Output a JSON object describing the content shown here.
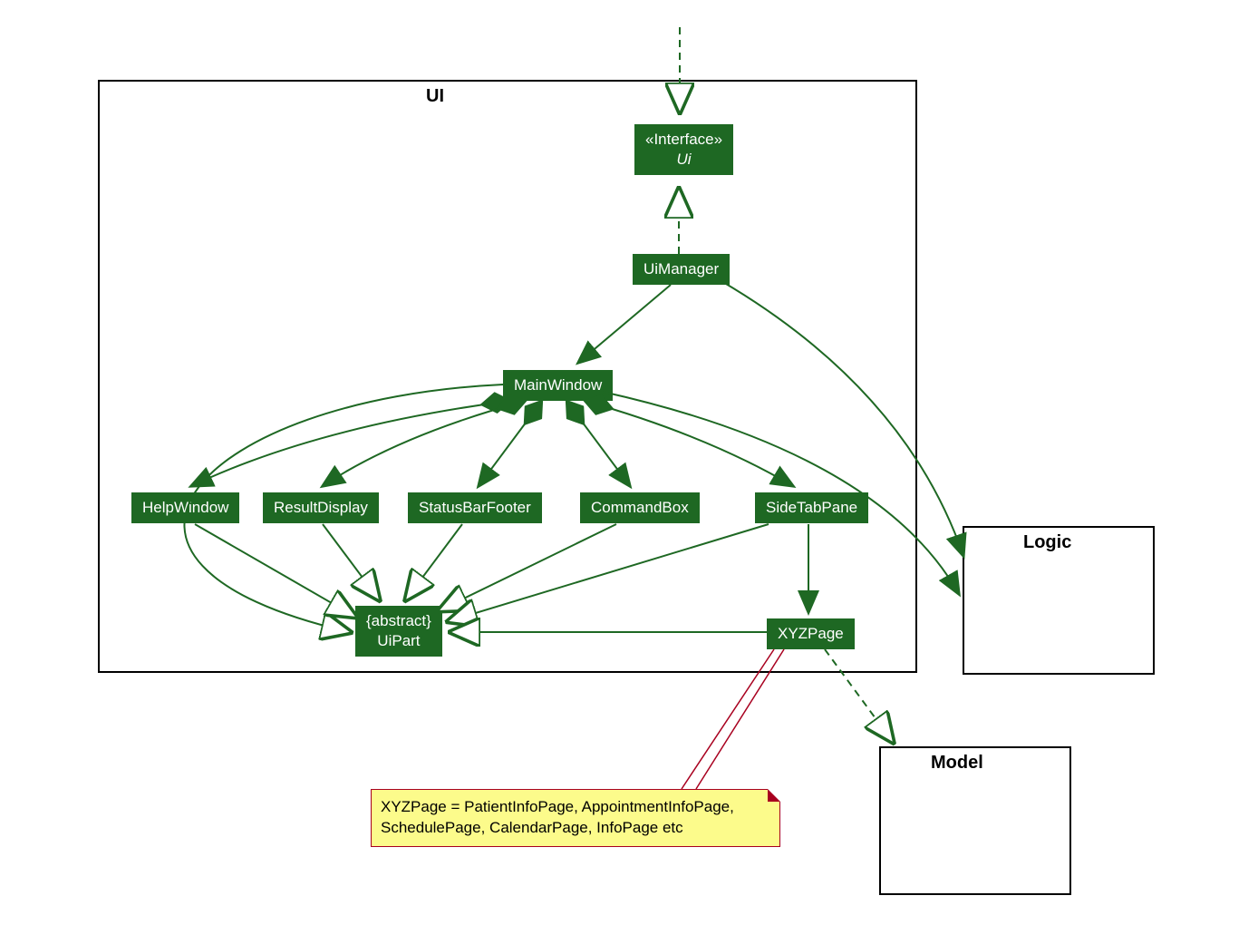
{
  "packages": {
    "ui": {
      "label": "UI"
    },
    "logic": {
      "label": "Logic"
    },
    "model": {
      "label": "Model"
    }
  },
  "classes": {
    "uiInterface": {
      "stereotype": "«Interface»",
      "name": "Ui"
    },
    "uiManager": {
      "name": "UiManager"
    },
    "mainWindow": {
      "name": "MainWindow"
    },
    "helpWindow": {
      "name": "HelpWindow"
    },
    "resultDisplay": {
      "name": "ResultDisplay"
    },
    "statusBarFooter": {
      "name": "StatusBarFooter"
    },
    "commandBox": {
      "name": "CommandBox"
    },
    "sideTabPane": {
      "name": "SideTabPane"
    },
    "uiPart": {
      "stereotype": "{abstract}",
      "name": "UiPart"
    },
    "xyzPage": {
      "name": "XYZPage"
    }
  },
  "note": {
    "text": "XYZPage = PatientInfoPage, AppointmentInfoPage, SchedulePage, CalendarPage, InfoPage etc"
  },
  "colors": {
    "classFill": "#1e6823",
    "edgeGreen": "#1e6823",
    "noteFill": "#fcfb8b",
    "noteBorder": "#a8001f"
  }
}
